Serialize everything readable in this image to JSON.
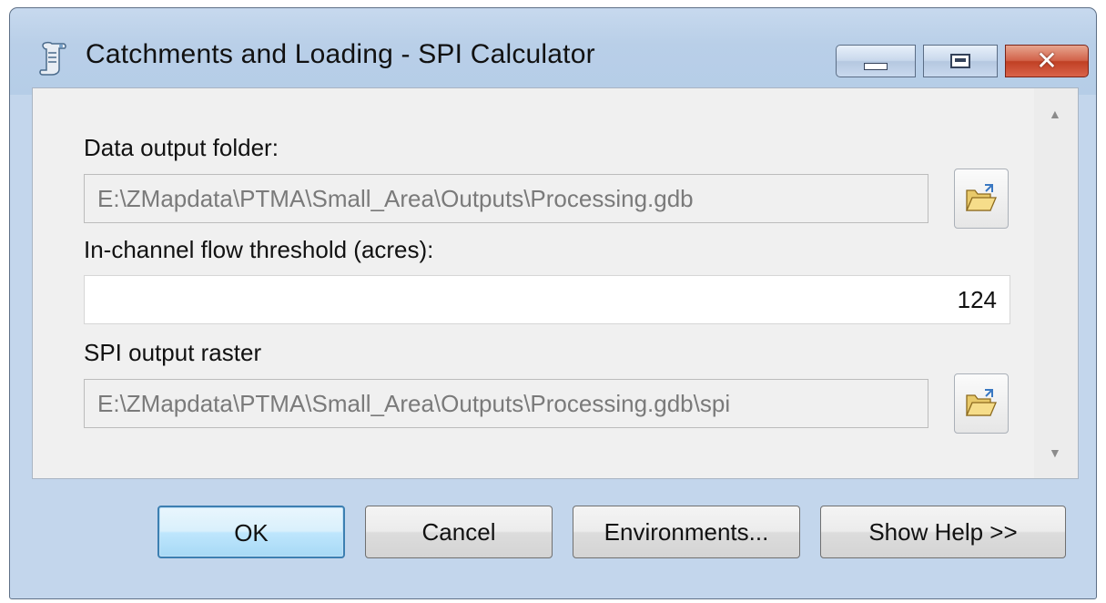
{
  "window": {
    "title": "Catchments and Loading - SPI Calculator"
  },
  "form": {
    "output_folder": {
      "label": "Data output folder:",
      "value": "E:\\ZMapdata\\PTMA\\Small_Area\\Outputs\\Processing.gdb"
    },
    "flow_threshold": {
      "label": "In-channel flow threshold (acres):",
      "value": "124"
    },
    "spi_raster": {
      "label": "SPI output raster",
      "value": "E:\\ZMapdata\\PTMA\\Small_Area\\Outputs\\Processing.gdb\\spi"
    }
  },
  "buttons": {
    "ok": "OK",
    "cancel": "Cancel",
    "environments": "Environments...",
    "show_help": "Show Help >>"
  },
  "icons": {
    "app": "toolbox-script-icon",
    "browse": "open-folder-icon",
    "minimize": "minimize-icon",
    "maximize": "maximize-icon",
    "close": "close-icon"
  },
  "colors": {
    "title_bar": "#b9cfe8",
    "close_button": "#c04024",
    "primary_button_border": "#3c7fb1"
  }
}
